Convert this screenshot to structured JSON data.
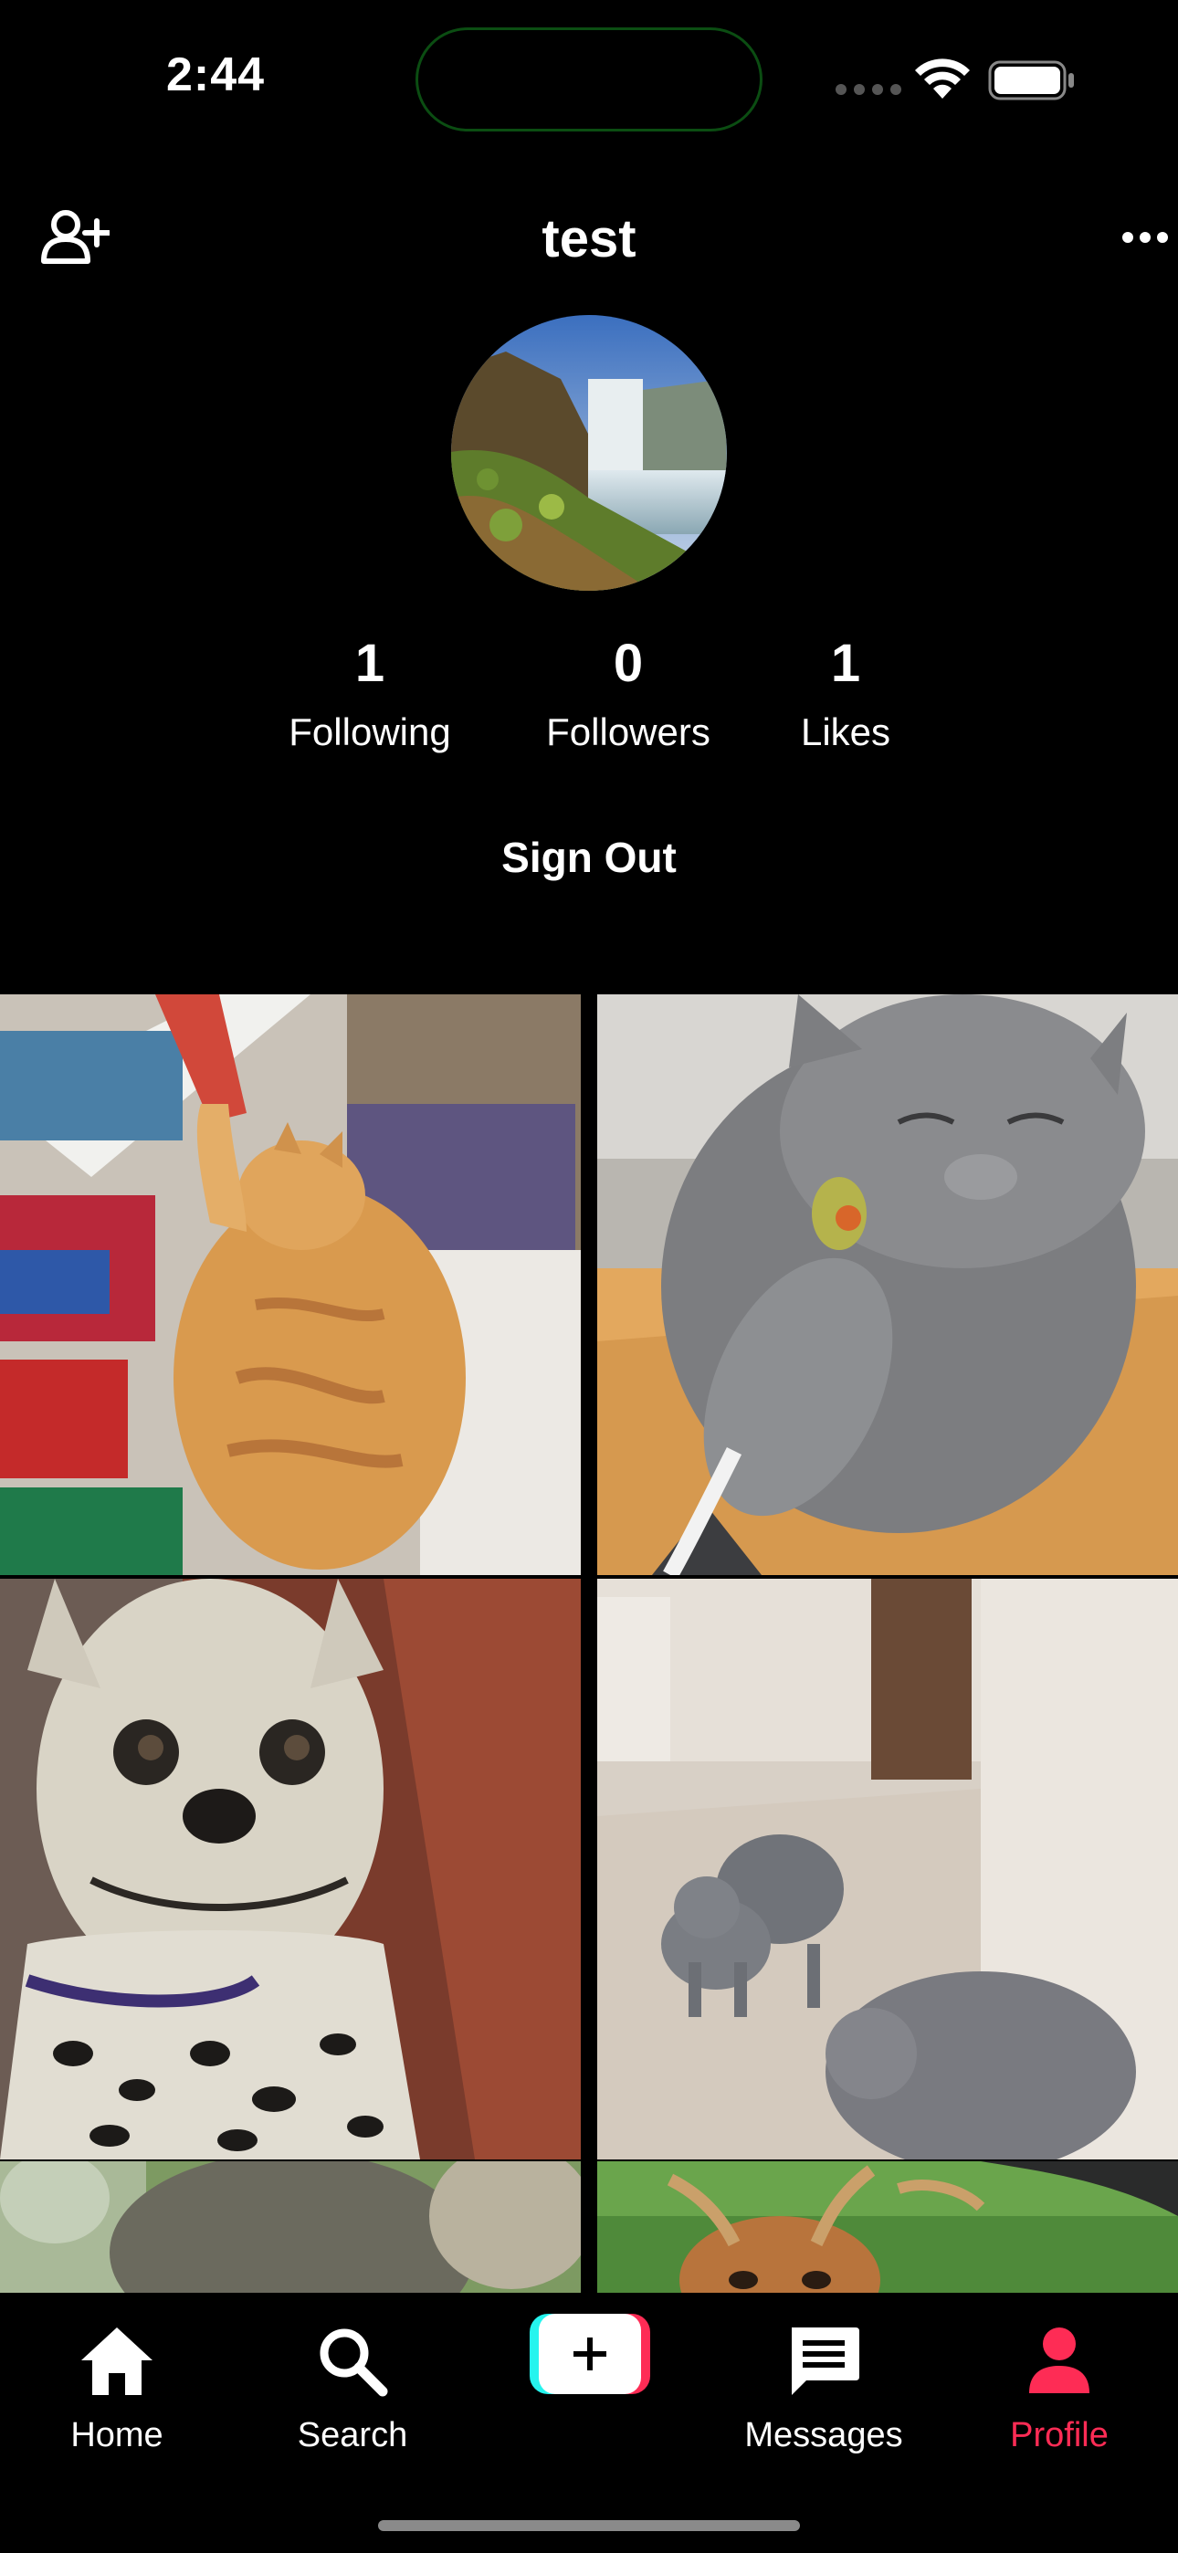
{
  "status_bar": {
    "time": "2:44"
  },
  "header": {
    "title": "test",
    "add_friend_icon": "person-add-icon",
    "more_icon": "more-horizontal-icon"
  },
  "profile": {
    "avatar": "waterfall-landscape-avatar",
    "stats": [
      {
        "value": "1",
        "label": "Following"
      },
      {
        "value": "0",
        "label": "Followers"
      },
      {
        "value": "1",
        "label": "Likes"
      }
    ],
    "sign_out_label": "Sign Out"
  },
  "videos": [
    {
      "thumbnail": "orange-tabby-cat-reaching-shelf"
    },
    {
      "thumbnail": "gray-cat-with-cockatiel"
    },
    {
      "thumbnail": "serval-cat-closeup"
    },
    {
      "thumbnail": "gray-cats-at-mirror"
    },
    {
      "thumbnail": "animal-outdoors"
    },
    {
      "thumbnail": "deer-with-antlers"
    }
  ],
  "bottom_nav": {
    "items": [
      {
        "label": "Home",
        "icon": "home-icon"
      },
      {
        "label": "Search",
        "icon": "search-icon"
      },
      {
        "label": "",
        "icon": "plus-icon"
      },
      {
        "label": "Messages",
        "icon": "messages-icon"
      },
      {
        "label": "Profile",
        "icon": "profile-icon",
        "active": true
      }
    ],
    "active_color": "#fe2c55"
  },
  "colors": {
    "background": "#000000",
    "accent_pink": "#fe2c55",
    "accent_cyan": "#25f4ee"
  }
}
